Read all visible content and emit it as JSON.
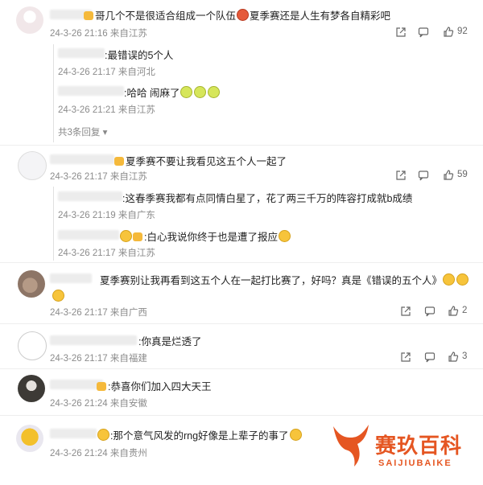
{
  "comments": [
    {
      "text": "哥几个不是很适合组成一个队伍",
      "text2": "夏季赛还是人生有梦各自精彩吧",
      "date": "24-3-26 21:16",
      "loc": "来自江苏",
      "likes": "92"
    },
    {
      "text": "夏季赛不要让我看见这五个人一起了",
      "date": "24-3-26 21:17",
      "loc": "来自江苏",
      "likes": "59"
    },
    {
      "text": "夏季赛别让我再看到这五个人在一起打比赛了，好吗？真是《错误的五个人》",
      "date": "24-3-26 21:17",
      "loc": "来自广西",
      "likes": "2"
    },
    {
      "text": ":你真是烂透了",
      "date": "24-3-26 21:17",
      "loc": "来自福建",
      "likes": "3"
    },
    {
      "text": ":恭喜你们加入四大天王",
      "date": "24-3-26 21:24",
      "loc": "来自安徽",
      "likes": ""
    },
    {
      "text": ":那个意气风发的rng好像是上辈子的事了",
      "date": "24-3-26 21:24",
      "loc": "来自贵州",
      "likes": ""
    }
  ],
  "replies1": [
    {
      "text": ":最错误的5个人",
      "date": "24-3-26 21:17",
      "loc": "来自河北"
    },
    {
      "text": ":哈哈 闹麻了",
      "date": "24-3-26 21:21",
      "loc": "来自江苏"
    }
  ],
  "more1": "共3条回复",
  "replies2": [
    {
      "text": ":这春季赛我都有点同情白星了，花了两三千万的阵容打成就b成绩",
      "date": "24-3-26 21:19",
      "loc": "来自广东"
    },
    {
      "text": ":白心我说你终于也是遭了报应",
      "date": "24-3-26 21:17",
      "loc": "来自江苏"
    }
  ],
  "watermark": {
    "title": "赛玖百科",
    "sub": "SAIJIUBAIKE",
    "color": "#e55622"
  }
}
